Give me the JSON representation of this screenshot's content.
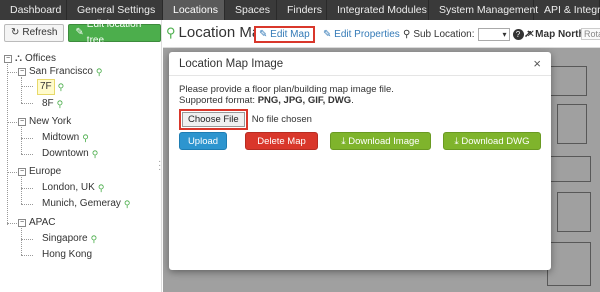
{
  "nav": {
    "tabs": [
      {
        "label": "Dashboard",
        "active": false
      },
      {
        "label": "General Settings",
        "active": false
      },
      {
        "label": "Locations",
        "active": true
      },
      {
        "label": "Spaces",
        "active": false
      },
      {
        "label": "Finders",
        "active": false
      },
      {
        "label": "Integrated Modules",
        "active": false
      },
      {
        "label": "System Management",
        "active": false
      },
      {
        "label": "API & Integration",
        "active": false
      }
    ]
  },
  "sidebar": {
    "refresh_label": "Refresh",
    "edit_tree_label": "Edit location tree",
    "tree": {
      "root": "Offices",
      "groups": [
        {
          "name": "San Francisco",
          "children": [
            "7F",
            "8F"
          ]
        },
        {
          "name": "New York",
          "children": [
            "Midtown",
            "Downtown"
          ]
        },
        {
          "name": "Europe",
          "children": [
            "London, UK",
            "Munich, Gemeray"
          ]
        },
        {
          "name": "APAC",
          "children": [
            "Singapore",
            "Hong Kong"
          ]
        }
      ],
      "selected": "7F"
    }
  },
  "header": {
    "title": "Location Map",
    "edit_map_label": "Edit Map",
    "edit_properties_label": "Edit Properties",
    "sub_location_label": "Sub Location:",
    "map_north_label": "Map North:",
    "rotate_label": "Rota"
  },
  "modal": {
    "title": "Location Map Image",
    "close": "×",
    "instruction": "Please provide a floor plan/building map image file.",
    "supported_prefix": "Supported format:",
    "supported_formats": "PNG, JPG, GIF, DWG",
    "choose_file_label": "Choose File",
    "no_file_label": "No file chosen",
    "upload_label": "Upload",
    "delete_label": "Delete Map",
    "download_image_label": "Download Image",
    "download_dwg_label": "Download DWG"
  },
  "colors": {
    "nav_bg": "#3a3a3a",
    "green": "#4cae4c",
    "red_highlight": "#d9372b",
    "blue_button": "#2d95cf",
    "olive_button": "#7fb42c"
  }
}
